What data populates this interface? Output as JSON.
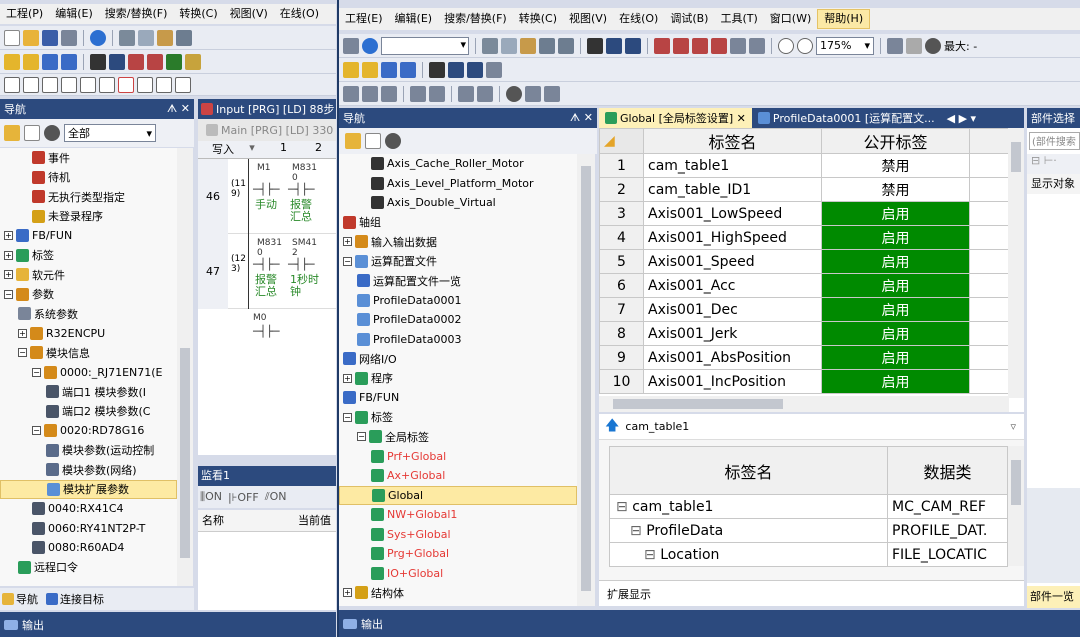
{
  "back_window": {
    "menu": [
      "工程(P)",
      "编辑(E)",
      "搜索/替换(F)",
      "转换(C)",
      "视图(V)",
      "在线(O)"
    ],
    "nav_title": "导航",
    "nav_filter": "全部",
    "tree": [
      {
        "label": "事件",
        "indent": 2,
        "icon": "event-icon"
      },
      {
        "label": "待机",
        "indent": 2,
        "icon": "standby-icon"
      },
      {
        "label": "无执行类型指定",
        "indent": 2,
        "icon": "noexec-icon"
      },
      {
        "label": "未登录程序",
        "indent": 2,
        "icon": "unregistered-icon"
      },
      {
        "label": "FB/FUN",
        "indent": 0,
        "icon": "fbfun-icon",
        "exp": "+"
      },
      {
        "label": "标签",
        "indent": 0,
        "icon": "label-icon",
        "exp": "+"
      },
      {
        "label": "软元件",
        "indent": 0,
        "icon": "device-icon",
        "exp": "+"
      },
      {
        "label": "参数",
        "indent": 0,
        "icon": "param-icon",
        "exp": "-"
      },
      {
        "label": "系统参数",
        "indent": 1,
        "icon": "sysparam-icon"
      },
      {
        "label": "R32ENCPU",
        "indent": 1,
        "icon": "cpu-icon",
        "exp": "+"
      },
      {
        "label": "模块信息",
        "indent": 1,
        "icon": "module-icon",
        "exp": "-"
      },
      {
        "label": "0000:_RJ71EN71(E",
        "indent": 2,
        "icon": "module-icon",
        "exp": "-"
      },
      {
        "label": "端口1 模块参数(I",
        "indent": 3,
        "icon": "port-icon"
      },
      {
        "label": "端口2 模块参数(C",
        "indent": 3,
        "icon": "port-icon"
      },
      {
        "label": "0020:RD78G16",
        "indent": 2,
        "icon": "module-icon",
        "exp": "-"
      },
      {
        "label": "模块参数(运动控制",
        "indent": 3,
        "icon": "modparam-icon"
      },
      {
        "label": "模块参数(网络)",
        "indent": 3,
        "icon": "modparam-icon"
      },
      {
        "label": "模块扩展参数",
        "indent": 3,
        "icon": "modext-icon",
        "selected": true
      },
      {
        "label": "0040:RX41C4",
        "indent": 2,
        "icon": "io-icon"
      },
      {
        "label": "0060:RY41NT2P-T",
        "indent": 2,
        "icon": "io-icon"
      },
      {
        "label": "0080:R60AD4",
        "indent": 2,
        "icon": "io-icon"
      },
      {
        "label": "远程口令",
        "indent": 1,
        "icon": "remote-icon"
      }
    ],
    "bottom_tabs": [
      "导航",
      "连接目标"
    ],
    "output": "输出",
    "program_tab": "Input [PRG] [LD] 88步",
    "main_tab": "Main [PRG] [LD] 330",
    "write_label": "写入",
    "cols": [
      "1",
      "2"
    ],
    "rows": [
      {
        "step": "46",
        "ref": "(11\n9)",
        "contacts": [
          "M1",
          "M831\n0"
        ],
        "text": [
          "手动",
          "报警\n汇总"
        ]
      },
      {
        "step": "47",
        "ref": "(12\n3)",
        "contacts": [
          "M831\n0",
          "SM41\n2"
        ],
        "text": [
          "报警\n汇总",
          "1秒时\n钟"
        ]
      }
    ],
    "next_contact": "M0",
    "monitor_title": "监看1",
    "monitor_buttons": [
      "ON",
      "OFF",
      "ON"
    ],
    "monitor_cols": [
      "名称",
      "当前值"
    ]
  },
  "front_window": {
    "menu": [
      "工程(E)",
      "编辑(E)",
      "搜索/替换(F)",
      "转换(C)",
      "视图(V)",
      "在线(O)",
      "调试(B)",
      "工具(T)",
      "窗口(W)",
      "帮助(H)"
    ],
    "zoom": "175%",
    "max_label": "最大: -",
    "nav_title": "导航",
    "tree": [
      {
        "label": "Axis_Cache_Roller_Motor",
        "indent": 2,
        "icon": "axis-icon"
      },
      {
        "label": "Axis_Level_Platform_Motor",
        "indent": 2,
        "icon": "axis-icon"
      },
      {
        "label": "Axis_Double_Virtual",
        "indent": 2,
        "icon": "axis-icon"
      },
      {
        "label": "轴组",
        "indent": 0,
        "icon": "axisgroup-icon"
      },
      {
        "label": "输入输出数据",
        "indent": 0,
        "icon": "iodata-icon",
        "exp": "+"
      },
      {
        "label": "运算配置文件",
        "indent": 0,
        "icon": "profile-icon",
        "exp": "-"
      },
      {
        "label": "运算配置文件一览",
        "indent": 1,
        "icon": "list-icon"
      },
      {
        "label": "ProfileData0001",
        "indent": 1,
        "icon": "profiledata-icon"
      },
      {
        "label": "ProfileData0002",
        "indent": 1,
        "icon": "profiledata-icon"
      },
      {
        "label": "ProfileData0003",
        "indent": 1,
        "icon": "profiledata-icon"
      },
      {
        "label": "网络I/O",
        "indent": 0,
        "icon": "netio-icon"
      },
      {
        "label": "程序",
        "indent": 0,
        "icon": "program-icon",
        "exp": "+"
      },
      {
        "label": "FB/FUN",
        "indent": 0,
        "icon": "fbfun-icon"
      },
      {
        "label": "标签",
        "indent": 0,
        "icon": "label-icon",
        "exp": "-"
      },
      {
        "label": "全局标签",
        "indent": 1,
        "icon": "globallabel-icon",
        "exp": "-"
      },
      {
        "label": "Prf+Global",
        "indent": 2,
        "icon": "globallabel-icon",
        "red": true
      },
      {
        "label": "Ax+Global",
        "indent": 2,
        "icon": "globallabel-icon",
        "red": true
      },
      {
        "label": "Global",
        "indent": 2,
        "icon": "globallabel-icon",
        "selected": true
      },
      {
        "label": "NW+Global1",
        "indent": 2,
        "icon": "globallabel-icon",
        "red": true
      },
      {
        "label": "Sys+Global",
        "indent": 2,
        "icon": "globallabel-icon",
        "red": true
      },
      {
        "label": "Prg+Global",
        "indent": 2,
        "icon": "globallabel-icon",
        "red": true
      },
      {
        "label": "IO+Global",
        "indent": 2,
        "icon": "globallabel-icon",
        "red": true
      },
      {
        "label": "结构体",
        "indent": 0,
        "icon": "struct-icon",
        "exp": "+"
      }
    ],
    "output": "输出",
    "tabs": [
      "Global [全局标签设置]",
      "ProfileData0001 [运算配置文..."
    ],
    "table_headers": [
      "标签名",
      "公开标签"
    ],
    "table_rows": [
      {
        "n": "1",
        "name": "cam_table1",
        "state": "禁用",
        "on": false
      },
      {
        "n": "2",
        "name": "cam_table_ID1",
        "state": "禁用",
        "on": false
      },
      {
        "n": "3",
        "name": "Axis001_LowSpeed",
        "state": "启用",
        "on": true
      },
      {
        "n": "4",
        "name": "Axis001_HighSpeed",
        "state": "启用",
        "on": true
      },
      {
        "n": "5",
        "name": "Axis001_Speed",
        "state": "启用",
        "on": true
      },
      {
        "n": "6",
        "name": "Axis001_Acc",
        "state": "启用",
        "on": true
      },
      {
        "n": "7",
        "name": "Axis001_Dec",
        "state": "启用",
        "on": true
      },
      {
        "n": "8",
        "name": "Axis001_Jerk",
        "state": "启用",
        "on": true
      },
      {
        "n": "9",
        "name": "Axis001_AbsPosition",
        "state": "启用",
        "on": true
      },
      {
        "n": "10",
        "name": "Axis001_IncPosition",
        "state": "启用",
        "on": true
      }
    ],
    "detail_selected": "cam_table1",
    "detail_headers": [
      "标签名",
      "数据类"
    ],
    "detail_rows": [
      {
        "name": "cam_table1",
        "type": "MC_CAM_REF",
        "indent": 0
      },
      {
        "name": "ProfileData",
        "type": "PROFILE_DAT.",
        "indent": 1
      },
      {
        "name": "Location",
        "type": "FILE_LOCATIC",
        "indent": 2
      }
    ],
    "expand_tab": "扩展显示",
    "parts_title": "部件选择",
    "parts_search": "(部件搜索",
    "parts_label": "显示对象",
    "parts_bottom": "部件一览"
  },
  "colors": {
    "navy": "#2c4a7e",
    "green": "#008a00",
    "highlight": "#fdeaa3",
    "red": "#e53935"
  }
}
